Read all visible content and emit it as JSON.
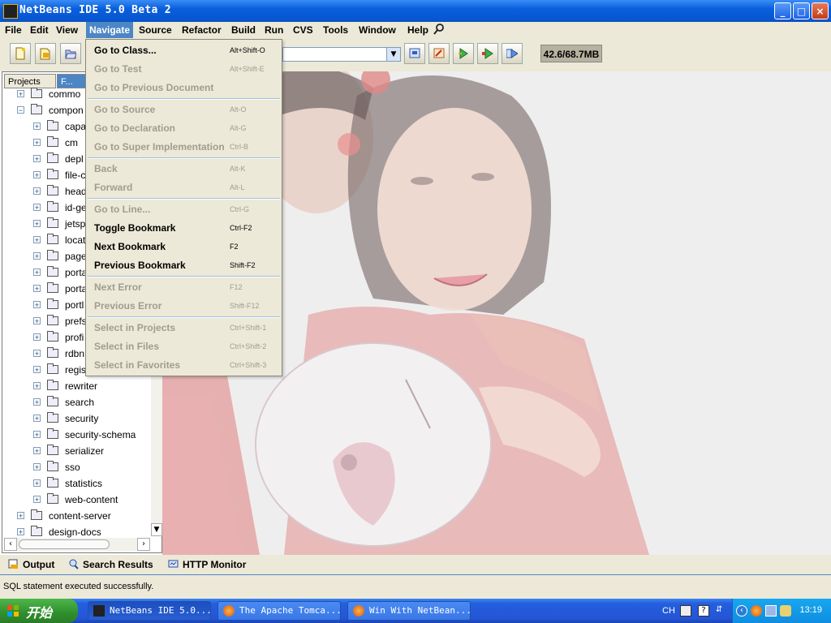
{
  "window": {
    "title": "NetBeans IDE 5.0 Beta 2",
    "controls": [
      "_",
      "□",
      "×"
    ]
  },
  "menubar": {
    "items": [
      {
        "label": "File"
      },
      {
        "label": "Edit"
      },
      {
        "label": "View"
      },
      {
        "label": "Navigate"
      },
      {
        "label": "Source"
      },
      {
        "label": "Refactor"
      },
      {
        "label": "Build"
      },
      {
        "label": "Run"
      },
      {
        "label": "CVS"
      },
      {
        "label": "Tools"
      },
      {
        "label": "Window"
      },
      {
        "label": "Help"
      }
    ],
    "active": "Navigate"
  },
  "toolbar": {
    "memory": "42.6/68.7MB",
    "config_combo_value": ""
  },
  "navigate_menu": {
    "items": [
      {
        "label": "Go to Class...",
        "shortcut": "Alt+Shift-O",
        "enabled": true
      },
      {
        "label": "Go to Test",
        "shortcut": "Alt+Shift-E",
        "enabled": false
      },
      {
        "label": "Go to Previous Document",
        "shortcut": "",
        "enabled": false
      },
      {
        "label": "Go to Source",
        "shortcut": "Alt-O",
        "enabled": false
      },
      {
        "label": "Go to Declaration",
        "shortcut": "Alt-G",
        "enabled": false
      },
      {
        "label": "Go to Super Implementation",
        "shortcut": "Ctrl-B",
        "enabled": false
      },
      {
        "label": "Back",
        "shortcut": "Alt-K",
        "enabled": false
      },
      {
        "label": "Forward",
        "shortcut": "Alt-L",
        "enabled": false
      },
      {
        "label": "Go to Line...",
        "shortcut": "Ctrl-G",
        "enabled": false
      },
      {
        "label": "Toggle Bookmark",
        "shortcut": "Ctrl-F2",
        "enabled": true
      },
      {
        "label": "Next Bookmark",
        "shortcut": "F2",
        "enabled": true
      },
      {
        "label": "Previous Bookmark",
        "shortcut": "Shift-F2",
        "enabled": true
      },
      {
        "label": "Next Error",
        "shortcut": "F12",
        "enabled": false
      },
      {
        "label": "Previous Error",
        "shortcut": "Shift-F12",
        "enabled": false
      },
      {
        "label": "Select in Projects",
        "shortcut": "Ctrl+Shift-1",
        "enabled": false
      },
      {
        "label": "Select in Files",
        "shortcut": "Ctrl+Shift-2",
        "enabled": false
      },
      {
        "label": "Select in Favorites",
        "shortcut": "Ctrl+Shift-3",
        "enabled": false
      }
    ]
  },
  "left_panel": {
    "tabs": [
      {
        "label": "Projects"
      },
      {
        "label": "F..."
      }
    ],
    "tree": [
      {
        "label": "commo",
        "level": 1
      },
      {
        "label": "compon",
        "level": 1,
        "open": true
      },
      {
        "label": "capa",
        "level": 2
      },
      {
        "label": "cm",
        "level": 2
      },
      {
        "label": "depl",
        "level": 2
      },
      {
        "label": "file-c",
        "level": 2
      },
      {
        "label": "head",
        "level": 2
      },
      {
        "label": "id-ge",
        "level": 2
      },
      {
        "label": "jetsp",
        "level": 2
      },
      {
        "label": "locat",
        "level": 2
      },
      {
        "label": "page",
        "level": 2
      },
      {
        "label": "porta",
        "level": 2
      },
      {
        "label": "porta",
        "level": 2
      },
      {
        "label": "portl",
        "level": 2
      },
      {
        "label": "prefs",
        "level": 2
      },
      {
        "label": "profi",
        "level": 2
      },
      {
        "label": "rdbn",
        "level": 2
      },
      {
        "label": "regis",
        "level": 2
      },
      {
        "label": "rewriter",
        "level": 2
      },
      {
        "label": "search",
        "level": 2
      },
      {
        "label": "security",
        "level": 2
      },
      {
        "label": "security-schema",
        "level": 2
      },
      {
        "label": "serializer",
        "level": 2
      },
      {
        "label": "sso",
        "level": 2
      },
      {
        "label": "statistics",
        "level": 2
      },
      {
        "label": "web-content",
        "level": 2
      },
      {
        "label": "content-server",
        "level": 1
      },
      {
        "label": "design-docs",
        "level": 1
      }
    ]
  },
  "output_tabs": [
    {
      "label": "Output",
      "icon": "output-icon"
    },
    {
      "label": "Search Results",
      "icon": "search-icon"
    },
    {
      "label": "HTTP Monitor",
      "icon": "http-monitor-icon"
    }
  ],
  "status": {
    "text": "SQL statement executed successfully."
  },
  "taskbar": {
    "start_label": "开始",
    "tasks": [
      {
        "label": "NetBeans IDE 5.0...",
        "active": true
      },
      {
        "label": "The Apache Tomca...",
        "active": false
      },
      {
        "label": "Win With NetBean...",
        "active": false
      }
    ],
    "lang": "CH",
    "clock": "13:19"
  },
  "colors": {
    "accent": "#4c86c5",
    "titlebar": "#0a5fdc",
    "chrome": "#ece9d8",
    "disabled_text": "#a09d90"
  }
}
